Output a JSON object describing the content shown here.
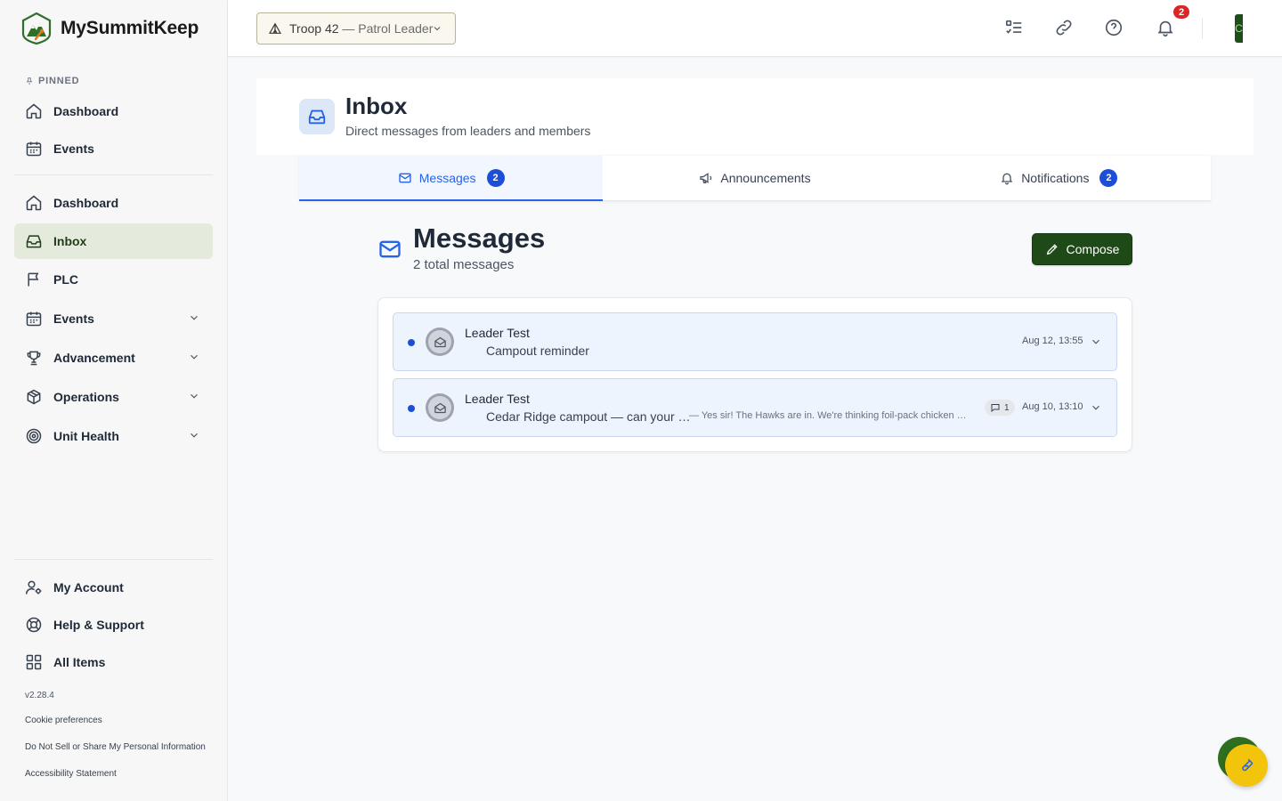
{
  "app": {
    "brand": "MySummitKeep"
  },
  "sidebar": {
    "pinned_label": "PINNED",
    "pinned": [
      {
        "label": "Dashboard",
        "icon": "home-icon"
      },
      {
        "label": "Events",
        "icon": "calendar-icon"
      }
    ],
    "items": [
      {
        "label": "Dashboard",
        "icon": "home-icon",
        "expandable": false
      },
      {
        "label": "Inbox",
        "icon": "inbox-icon",
        "expandable": false,
        "active": true
      },
      {
        "label": "PLC",
        "icon": "flag-icon",
        "expandable": false
      },
      {
        "label": "Events",
        "icon": "calendar-icon",
        "expandable": true
      },
      {
        "label": "Advancement",
        "icon": "trophy-icon",
        "expandable": true
      },
      {
        "label": "Operations",
        "icon": "box-icon",
        "expandable": true
      },
      {
        "label": "Unit Health",
        "icon": "target-icon",
        "expandable": true
      }
    ],
    "bottom": [
      {
        "label": "My Account",
        "icon": "user-settings-icon"
      },
      {
        "label": "Help & Support",
        "icon": "lifebuoy-icon"
      },
      {
        "label": "All Items",
        "icon": "grid-icon"
      }
    ],
    "version": "v2.28.4",
    "footer_links": [
      "Cookie preferences",
      "Do Not Sell or Share My Personal Information",
      "Accessibility Statement"
    ]
  },
  "topbar": {
    "troop_name": "Troop 42",
    "troop_role": " — Patrol Leader",
    "notification_count": "2",
    "avatar_initial": "C"
  },
  "page": {
    "title": "Inbox",
    "subtitle": "Direct messages from leaders and members"
  },
  "tabs": [
    {
      "label": "Messages",
      "count": "2",
      "active": true
    },
    {
      "label": "Announcements"
    },
    {
      "label": "Notifications",
      "count": "2"
    }
  ],
  "messages": {
    "title": "Messages",
    "count_text": "2 total messages",
    "compose_label": "Compose",
    "list": [
      {
        "sender": "Leader Test",
        "subject": "Campout reminder",
        "preview": "",
        "replies": "",
        "date": "Aug 12, 13:55",
        "unread": true
      },
      {
        "sender": "Leader Test",
        "subject": "Cedar Ridge campout — can your …",
        "preview": "— Yes sir! The Hawks are in. We're thinking foil-pack chicken …",
        "replies": "1",
        "date": "Aug 10, 13:10",
        "unread": true
      }
    ]
  },
  "colors": {
    "accent_blue": "#2563eb",
    "brand_green": "#1e4a17",
    "active_nav_bg": "#e4ebdd",
    "badge_red": "#dc2626",
    "fab_yellow": "#f2c40c"
  }
}
